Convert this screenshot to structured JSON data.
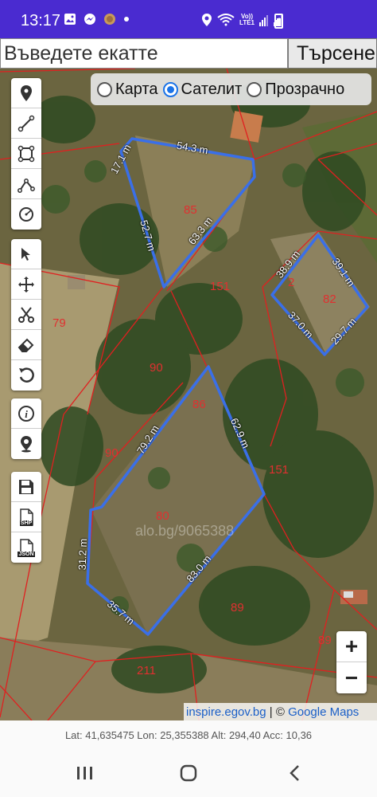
{
  "status_bar": {
    "time": "13:17",
    "left_icons": [
      "image-icon",
      "messenger-icon",
      "coin-icon",
      "dot-icon"
    ],
    "right_icons": [
      "location-icon",
      "wifi-icon",
      "volte-icon",
      "signal-icon",
      "signal-icon",
      "battery-icon"
    ],
    "lte_text_top": "Vo))",
    "lte_text_bottom": "LTE1"
  },
  "search": {
    "placeholder": "Въведете екатте",
    "button_label": "Търсене"
  },
  "layers": {
    "options": [
      "Карта",
      "Сателит",
      "Прозрачно"
    ],
    "selected": "Сателит"
  },
  "tools": {
    "group1": [
      "marker-icon",
      "line-icon",
      "polygon-icon",
      "path-icon",
      "circle-icon"
    ],
    "group2": [
      "select-icon",
      "move-icon",
      "cut-icon",
      "eraser-icon",
      "undo-icon"
    ],
    "group3": [
      "info-icon",
      "locate-icon"
    ],
    "group4": [
      "save-icon",
      "shp-file-icon",
      "json-file-icon"
    ],
    "shp_label": "SHP",
    "json_label": "JSON"
  },
  "map": {
    "parcel_numbers": [
      "85",
      "151",
      "82",
      "79",
      "90",
      "86",
      "90",
      "80",
      "151",
      "89",
      "89",
      "211"
    ],
    "parcel_numbers_fragment": "2",
    "measurements": [
      "54.3 m",
      "17.1 m",
      "52.7 m",
      "63.3 m",
      "38.9 m",
      "39.1 m",
      "37.0 m",
      "29.7 m",
      "79.2 m",
      "62.9 m",
      "31.2 m",
      "83.0 m",
      "35.7 m"
    ],
    "watermark": "alo.bg/9065388",
    "boundary_color": "#e02020",
    "measure_color": "#3a6fe8"
  },
  "zoom": {
    "in_label": "+",
    "out_label": "−"
  },
  "attribution": {
    "link_text": "inspire.egov.bg",
    "separator": " | © ",
    "provider": "Google Maps"
  },
  "coords_text": "Lat: 41,635475 Lon: 25,355388 Alt: 294,40 Acc: 10,36",
  "nav": [
    "recents-icon",
    "home-icon",
    "back-icon"
  ]
}
